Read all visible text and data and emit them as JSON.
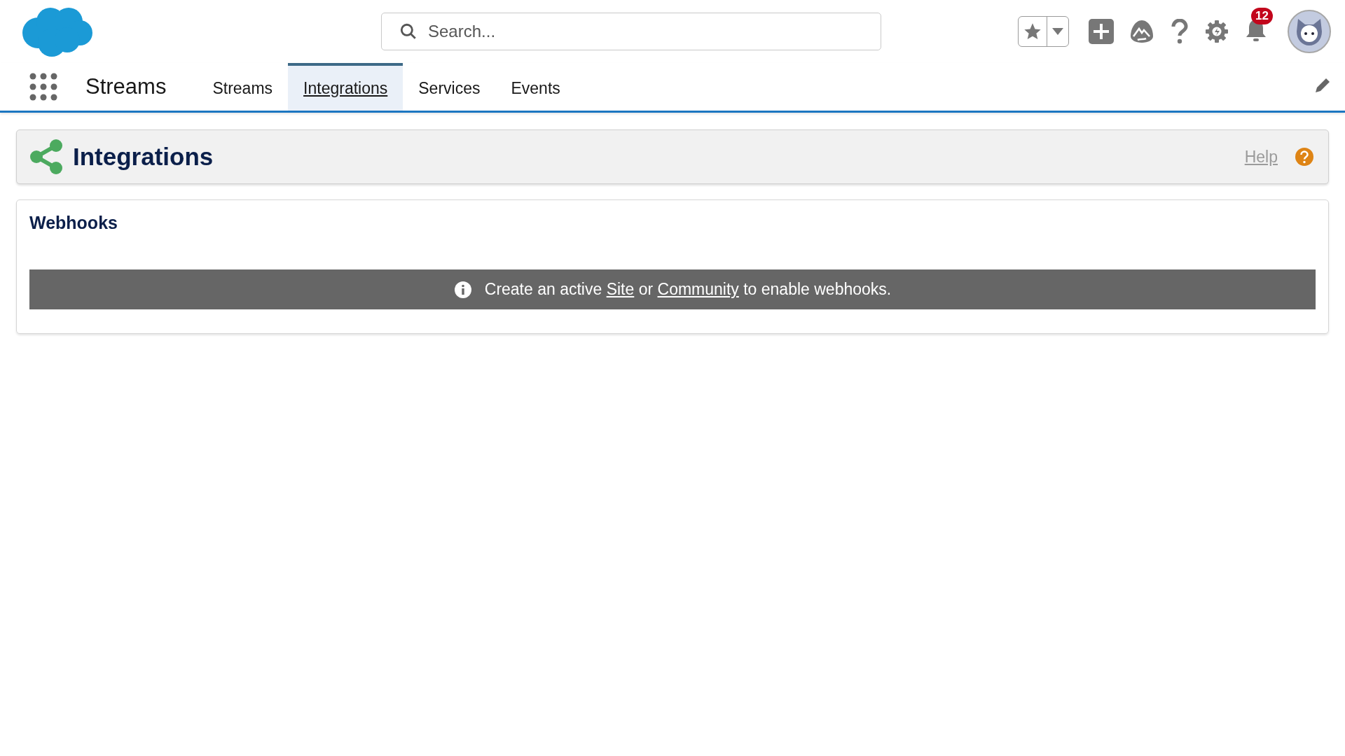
{
  "header": {
    "search": {
      "placeholder": "Search..."
    },
    "notifications": {
      "count": "12"
    }
  },
  "nav": {
    "app_name": "Streams",
    "tabs": [
      {
        "label": "Streams",
        "selected": false
      },
      {
        "label": "Integrations",
        "selected": true
      },
      {
        "label": "Services",
        "selected": false
      },
      {
        "label": "Events",
        "selected": false
      }
    ]
  },
  "page_header": {
    "title": "Integrations",
    "help": "Help"
  },
  "webhooks": {
    "title": "Webhooks",
    "message": [
      {
        "kind": "text",
        "text": "Create an active "
      },
      {
        "kind": "link",
        "text": "Site"
      },
      {
        "kind": "text",
        "text": " or "
      },
      {
        "kind": "link",
        "text": "Community"
      },
      {
        "kind": "text",
        "text": " to enable webhooks."
      }
    ]
  }
}
